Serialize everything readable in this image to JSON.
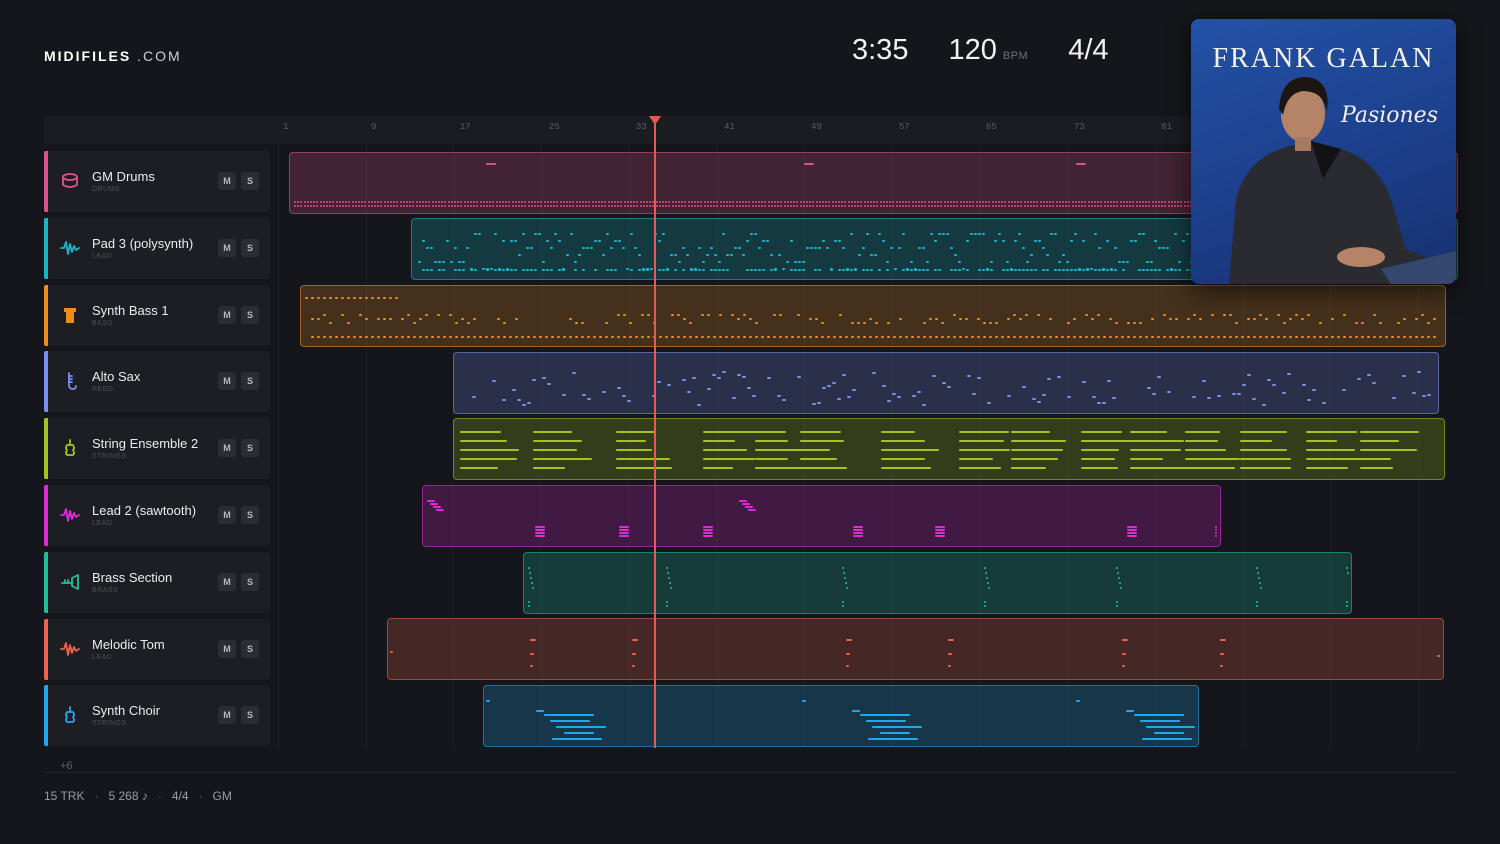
{
  "brand": {
    "name": "MIDIFILES",
    "domain": ".COM"
  },
  "header": {
    "time": "3:35",
    "tempo": "120",
    "tempo_unit": "BPM",
    "meter": "4/4"
  },
  "timeline": {
    "bars": [
      "1",
      "9",
      "17",
      "25",
      "33",
      "41",
      "49",
      "57",
      "65",
      "73",
      "81"
    ]
  },
  "tracks": [
    {
      "name": "GM Drums",
      "category": "DRUMS",
      "color": "#e0508a",
      "icon": "drum-icon"
    },
    {
      "name": "Pad 3 (polysynth)",
      "category": "LEAD",
      "color": "#19b6c8",
      "icon": "wave-icon"
    },
    {
      "name": "Synth Bass 1",
      "category": "BASS",
      "color": "#f08c1a",
      "icon": "bass-icon"
    },
    {
      "name": "Alto Sax",
      "category": "REED",
      "color": "#7b8ef0",
      "icon": "sax-icon"
    },
    {
      "name": "String Ensemble 2",
      "category": "STRINGS",
      "color": "#a7c21e",
      "icon": "violin-icon"
    },
    {
      "name": "Lead 2 (sawtooth)",
      "category": "LEAD",
      "color": "#e02ad8",
      "icon": "wave-icon"
    },
    {
      "name": "Brass Section",
      "category": "BRASS",
      "color": "#1fbf9a",
      "icon": "trumpet-icon"
    },
    {
      "name": "Melodic Tom",
      "category": "LEAD",
      "color": "#f0624a",
      "icon": "wave-icon"
    },
    {
      "name": "Synth Choir",
      "category": "STRINGS",
      "color": "#20a7ee",
      "icon": "violin-icon"
    }
  ],
  "mute_label": "M",
  "solo_label": "S",
  "more_tracks": "+6",
  "footer": {
    "tracks": "15 TRK",
    "notes": "5 268 ♪",
    "meter": "4/4",
    "standard": "GM"
  },
  "album": {
    "artist": "FRANK GALAN",
    "title": "Pasiones"
  }
}
